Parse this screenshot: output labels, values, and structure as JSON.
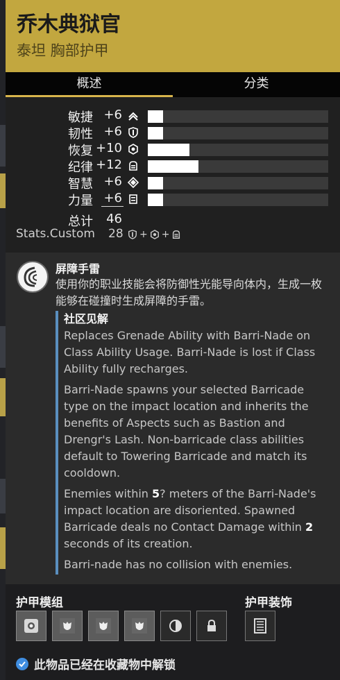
{
  "item": {
    "name": "乔木典狱官",
    "type": "泰坦 胸部护甲"
  },
  "tabs": [
    {
      "label": "概述",
      "active": true
    },
    {
      "label": "分类",
      "active": false
    }
  ],
  "stats": [
    {
      "name": "敏捷",
      "value": "+6",
      "icon": "mobility-icon",
      "fill_percent": 8.5
    },
    {
      "name": "韧性",
      "value": "+6",
      "icon": "resilience-icon",
      "fill_percent": 8.5
    },
    {
      "name": "恢复",
      "value": "+10",
      "icon": "recovery-icon",
      "fill_percent": 23
    },
    {
      "name": "纪律",
      "value": "+12",
      "icon": "discipline-icon",
      "fill_percent": 28
    },
    {
      "name": "智慧",
      "value": "+6",
      "icon": "intellect-icon",
      "fill_percent": 8.5
    },
    {
      "name": "力量",
      "value": "+6",
      "icon": "strength-icon",
      "fill_percent": 8.5
    }
  ],
  "total": {
    "label": "总计",
    "value": "46"
  },
  "custom": {
    "label": "Stats.Custom",
    "value": "28",
    "plus": "+"
  },
  "perk": {
    "name": "屏障手雷",
    "description": "使用你的职业技能会将防御性光能导向体内，生成一枚能够在碰撞时生成屏障的手雷。",
    "community_title": "社区见解",
    "paragraphs": [
      {
        "parts": [
          {
            "text": "Replaces Grenade Ability with Barri-Nade on Class Ability Usage. Barri-Nade is lost if Class Ability fully recharges."
          }
        ]
      },
      {
        "parts": [
          {
            "text": "Barri-Nade spawns your selected Barricade type on the impact location and inherits the benefits of Aspects such as Bastion and Drengr's Lash. Non-barricade class abilities default to Towering Barricade and match its cooldown."
          }
        ]
      },
      {
        "parts": [
          {
            "text": "Enemies within "
          },
          {
            "text": "5",
            "bold": true
          },
          {
            "text": "? meters of the Barri-Nade's impact location are disoriented. Spawned Barricade deals no Contact Damage within "
          },
          {
            "text": "2",
            "bold": true
          },
          {
            "text": " seconds of its creation."
          }
        ]
      },
      {
        "parts": [
          {
            "text": "Barri-nade has no collision with enemies."
          }
        ]
      }
    ]
  },
  "mods": {
    "title": "护甲模组",
    "ornament_title": "护甲装饰",
    "slots": [
      {
        "icon": "energy-mod-icon",
        "dark": false
      },
      {
        "icon": "mod-socket-icon",
        "dark": false
      },
      {
        "icon": "mod-socket-icon",
        "dark": false
      },
      {
        "icon": "mod-socket-icon",
        "dark": false
      },
      {
        "icon": "artifice-socket-icon",
        "dark": true
      },
      {
        "icon": "locked-socket-icon",
        "dark": true
      }
    ],
    "ornament": {
      "icon": "ornament-icon"
    }
  },
  "collection": {
    "text": "此物品已经在收藏物中解锁"
  },
  "colors": {
    "header": "#c2a73f",
    "tab_accent": "#d8b54c",
    "community_border": "#5a8fbf",
    "check": "#3f8de0"
  }
}
